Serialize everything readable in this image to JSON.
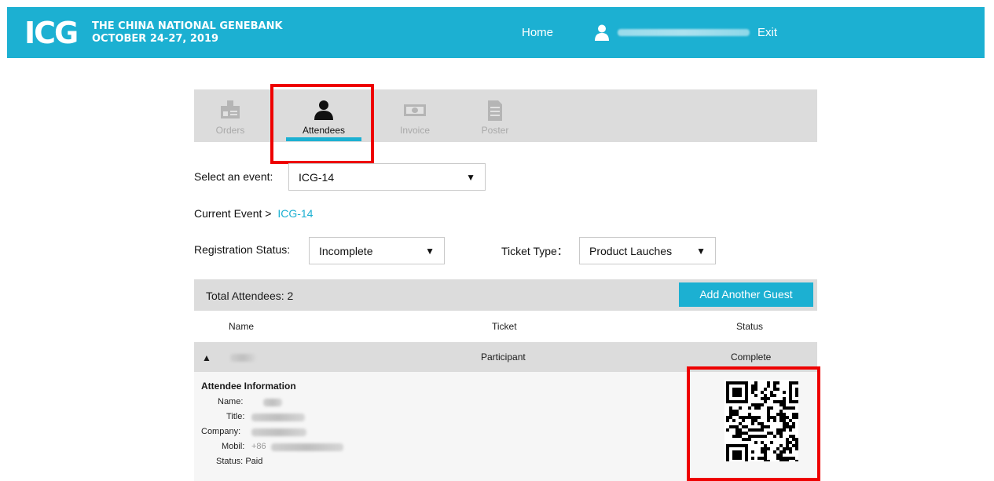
{
  "header": {
    "logo": "ICG",
    "org_line1": "THE CHINA NATIONAL GENEBANK",
    "org_line2": "OCTOBER 24-27, 2019",
    "home": "Home",
    "exit": "Exit"
  },
  "tabs": [
    {
      "label": "Orders",
      "icon": "badge-icon",
      "active": false
    },
    {
      "label": "Attendees",
      "icon": "person-icon",
      "active": true
    },
    {
      "label": "Invoice",
      "icon": "money-icon",
      "active": false
    },
    {
      "label": "Poster",
      "icon": "document-icon",
      "active": false
    }
  ],
  "event_select": {
    "label": "Select an event:",
    "value": "ICG-14",
    "arrow": "▼"
  },
  "current_event": {
    "label": "Current Event >",
    "value": "ICG-14"
  },
  "registration_status": {
    "label": "Registration Status:",
    "value": "Incomplete",
    "arrow": "▼"
  },
  "ticket_type": {
    "label": "Ticket Type：",
    "value": "Product Lauches",
    "arrow": "▼"
  },
  "table": {
    "total": "Total Attendees: 2",
    "add_button": "Add Another Guest",
    "columns": [
      "Name",
      "Ticket",
      "Status"
    ],
    "rows": [
      {
        "expander": "▲",
        "ticket": "Participant",
        "status": "Complete"
      }
    ]
  },
  "attendee_info": {
    "title": "Attendee Information",
    "name_label": "Name:",
    "title_label": "Title:",
    "company_label": "Company:",
    "mobile_label": "Mobil:",
    "mobile_prefix": "+86",
    "status_label": "Status:",
    "status_value": "Paid"
  },
  "colors": {
    "accent": "#1cb0d2",
    "highlight": "#ee0000",
    "panel": "#dcdcdc"
  }
}
